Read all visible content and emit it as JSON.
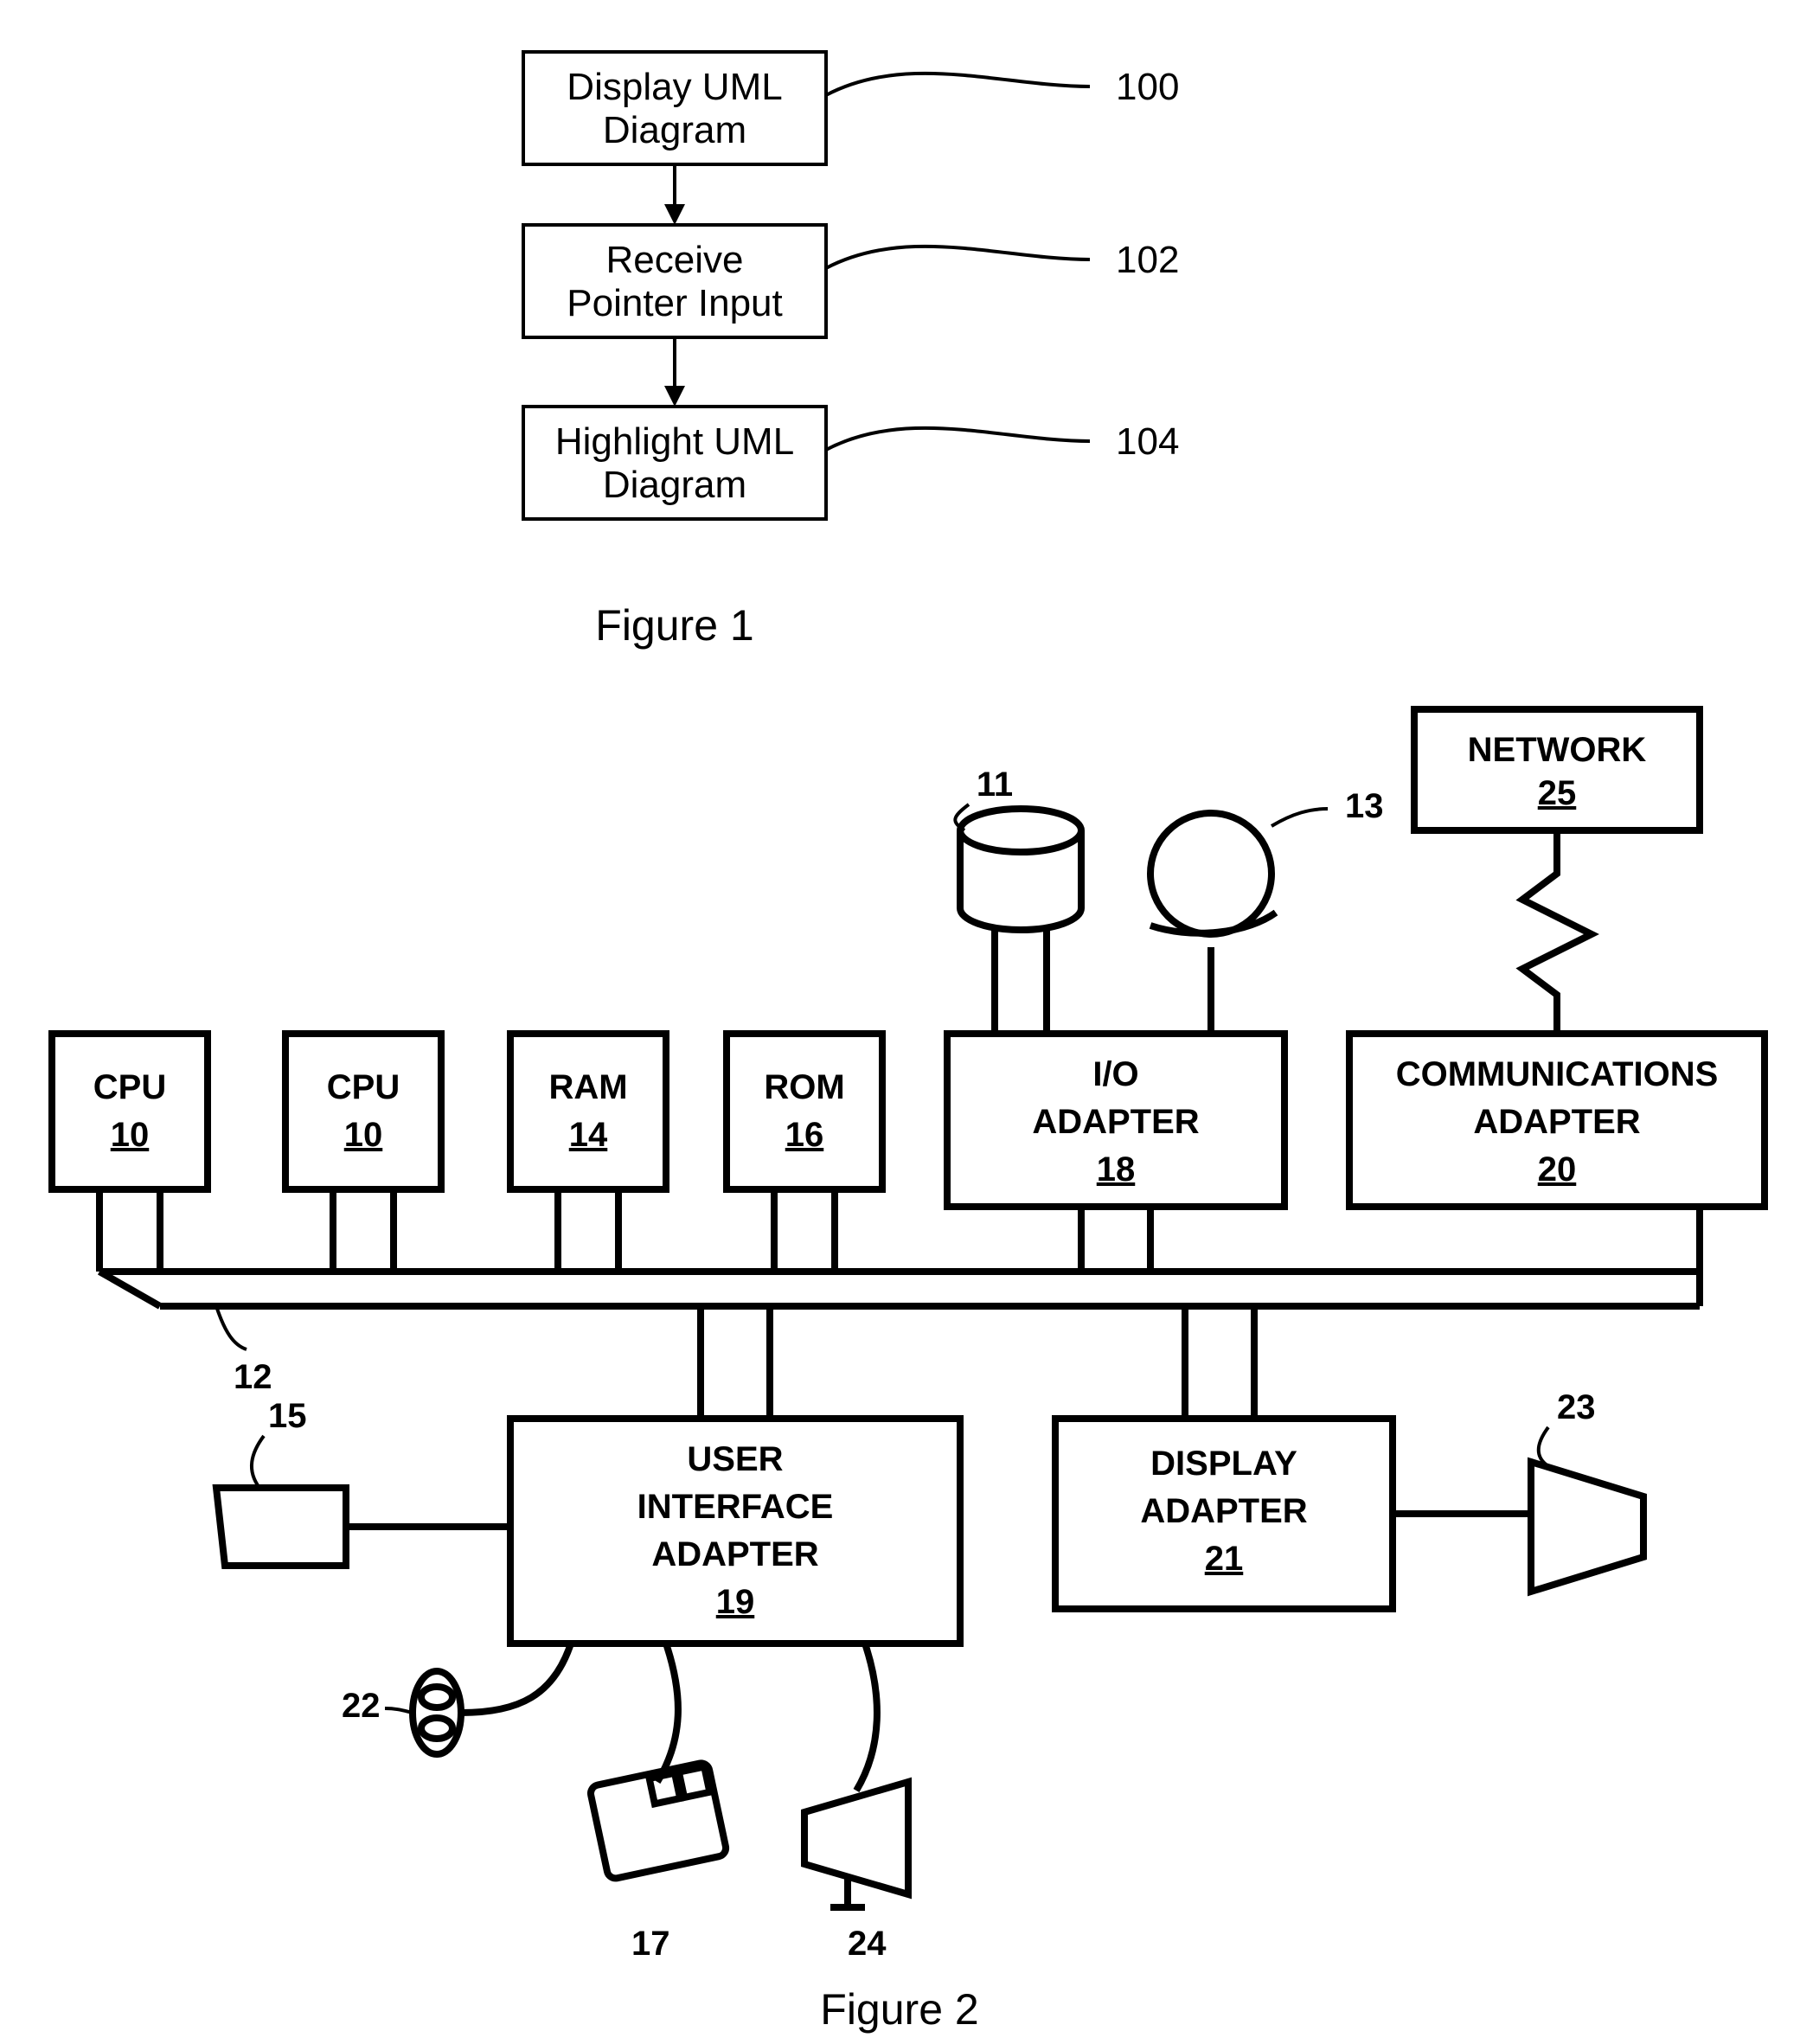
{
  "figure1": {
    "caption": "Figure 1",
    "steps": [
      {
        "line1": "Display UML",
        "line2": "Diagram",
        "ref": "100"
      },
      {
        "line1": "Receive",
        "line2": "Pointer Input",
        "ref": "102"
      },
      {
        "line1": "Highlight UML",
        "line2": "Diagram",
        "ref": "104"
      }
    ]
  },
  "figure2": {
    "caption": "Figure 2",
    "blocks": {
      "cpu1": {
        "label": "CPU",
        "ref": "10"
      },
      "cpu2": {
        "label": "CPU",
        "ref": "10"
      },
      "ram": {
        "label": "RAM",
        "ref": "14"
      },
      "rom": {
        "label": "ROM",
        "ref": "16"
      },
      "io": {
        "line1": "I/O",
        "line2": "ADAPTER",
        "ref": "18"
      },
      "comm": {
        "line1": "COMMUNICATIONS",
        "line2": "ADAPTER",
        "ref": "20"
      },
      "network": {
        "label": "NETWORK",
        "ref": "25"
      },
      "ui": {
        "line1": "USER",
        "line2": "INTERFACE",
        "line3": "ADAPTER",
        "ref": "19"
      },
      "disp": {
        "line1": "DISPLAY",
        "line2": "ADAPTER",
        "ref": "21"
      }
    },
    "labels": {
      "bus": "12",
      "disk": "11",
      "dvd": "13",
      "mic": "15",
      "joy": "22",
      "mouse": "17",
      "speaker": "24",
      "monitor": "23"
    }
  }
}
